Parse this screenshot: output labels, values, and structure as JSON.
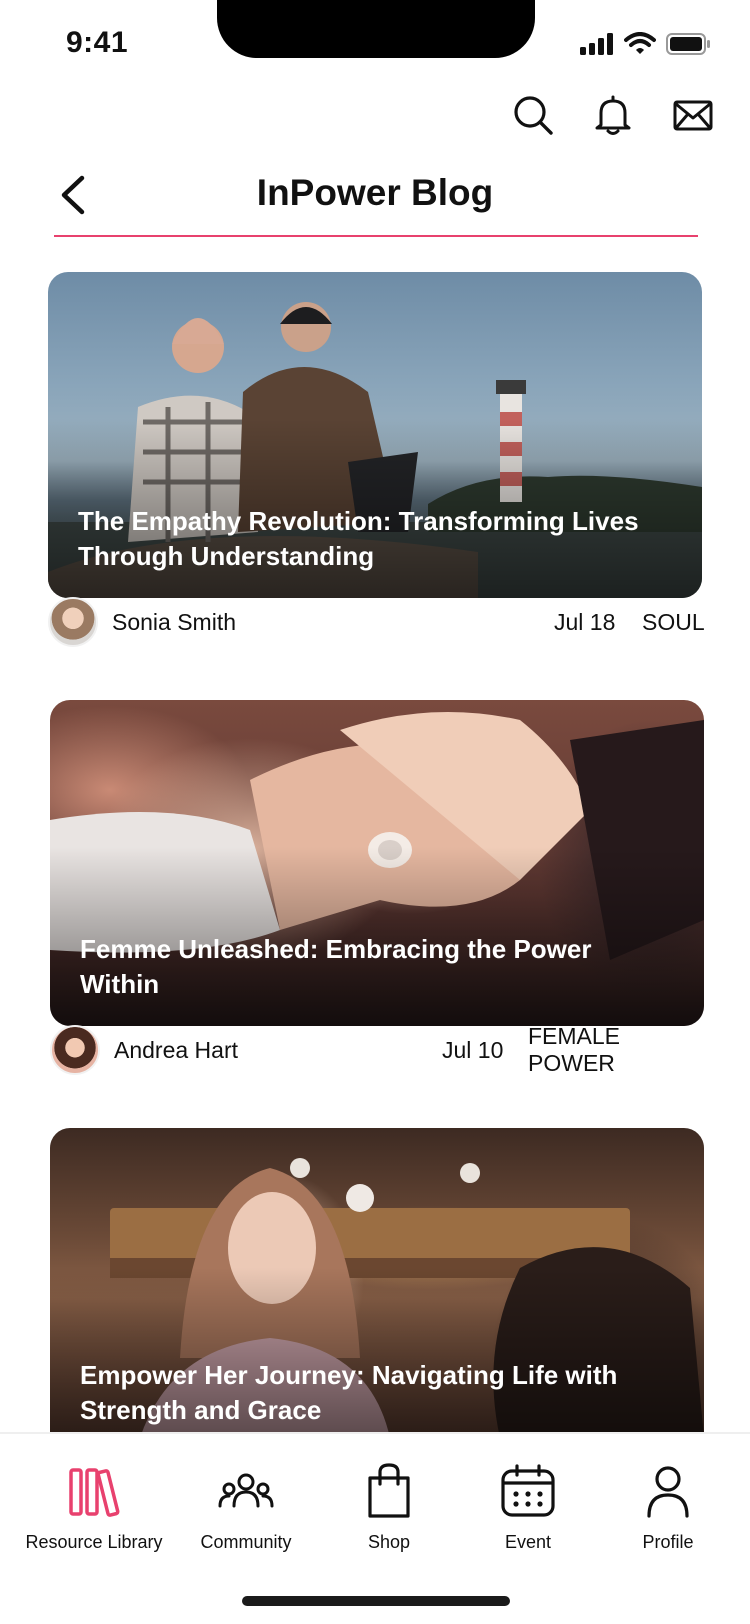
{
  "status_bar": {
    "time": "9:41"
  },
  "header": {
    "title": "InPower Blog",
    "actions": [
      {
        "icon": "search-icon"
      },
      {
        "icon": "bell-icon"
      },
      {
        "icon": "mail-icon"
      }
    ]
  },
  "colors": {
    "accent": "#e8416e",
    "text": "#111111",
    "background": "#ffffff"
  },
  "posts": [
    {
      "title": "The Empathy Revolution: Transforming Lives Through Understanding",
      "author": "Sonia Smith",
      "date": "Jul 18",
      "category": "SOUL"
    },
    {
      "title": "Femme Unleashed: Embracing the Power Within",
      "author": "Andrea Hart",
      "date": "Jul 10",
      "category": "FEMALE POWER"
    },
    {
      "title": "Empower Her Journey: Navigating Life with Strength and Grace"
    }
  ],
  "bottom_nav": [
    {
      "label": "Resource Library",
      "icon": "books-icon",
      "active": true
    },
    {
      "label": "Community",
      "icon": "community-icon",
      "active": false
    },
    {
      "label": "Shop",
      "icon": "shopping-bag-icon",
      "active": false
    },
    {
      "label": "Event",
      "icon": "calendar-icon",
      "active": false
    },
    {
      "label": "Profile",
      "icon": "person-icon",
      "active": false
    }
  ]
}
